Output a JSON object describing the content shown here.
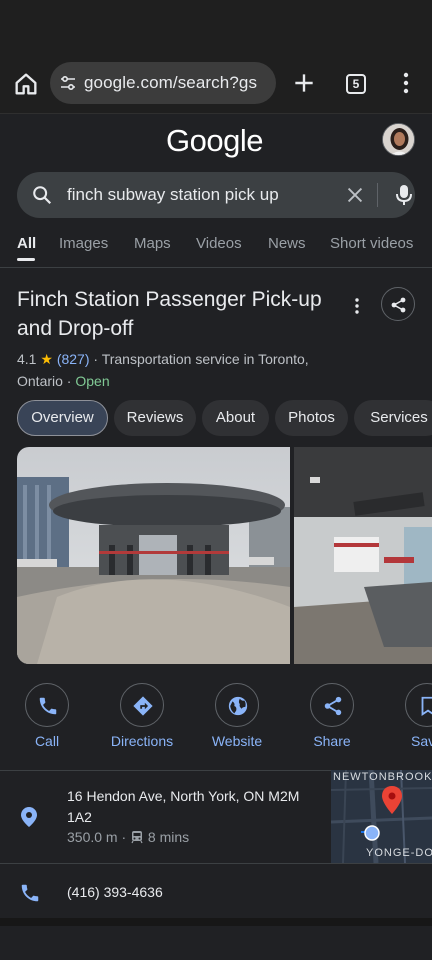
{
  "browser": {
    "url": "google.com/search?gs",
    "tab_count": "5"
  },
  "google": {
    "logo": "Google",
    "query": "finch subway station pick up"
  },
  "search_tabs": [
    "All",
    "Images",
    "Maps",
    "Videos",
    "News",
    "Short videos"
  ],
  "place": {
    "title": "Finch Station Passenger Pick-up and Drop-off",
    "rating": "4.1",
    "star": "★",
    "review_count": "(827)",
    "category": "· Transportation service in Toronto,",
    "region": "Ontario ·",
    "status": "Open"
  },
  "chips": [
    "Overview",
    "Reviews",
    "About",
    "Photos",
    "Services"
  ],
  "actions": [
    "Call",
    "Directions",
    "Website",
    "Share",
    "Save"
  ],
  "address": {
    "line": "16 Hendon Ave, North York, ON M2M 1A2",
    "distance": "350.0 m ·",
    "transit": "8 mins"
  },
  "map": {
    "top_label": "NEWTONBROOK",
    "bottom_label": "YONGE-DO"
  },
  "phone": "(416) 393-4636",
  "colors": {
    "accent": "#8ab4f8",
    "open": "#81c995",
    "star": "#fbbc04",
    "pin": "#ea4335"
  }
}
